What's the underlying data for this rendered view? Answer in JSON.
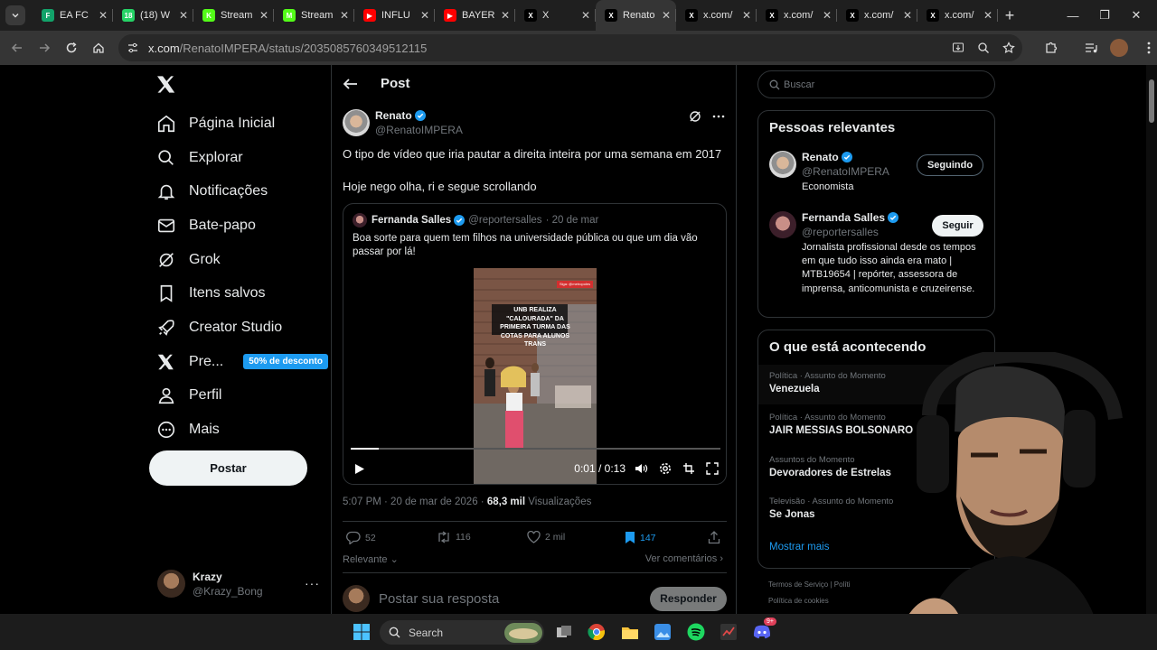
{
  "browser": {
    "tabs": [
      {
        "title": "EA FC",
        "color": "#12a36a",
        "letter": "F"
      },
      {
        "title": "(18) W",
        "color": "#25d366",
        "letter": "18"
      },
      {
        "title": "Stream",
        "color": "#53fc18",
        "letter": "K"
      },
      {
        "title": "Stream",
        "color": "#53fc18",
        "letter": "M"
      },
      {
        "title": "INFLU",
        "color": "#ff0000",
        "letter": "▶"
      },
      {
        "title": "BAYER",
        "color": "#ff0000",
        "letter": "▶"
      },
      {
        "title": "X",
        "color": "#000000",
        "letter": "X"
      },
      {
        "title": "Renato",
        "color": "#000000",
        "letter": "X"
      },
      {
        "title": "x.com/",
        "color": "#000000",
        "letter": "X"
      },
      {
        "title": "x.com/",
        "color": "#000000",
        "letter": "X"
      },
      {
        "title": "x.com/",
        "color": "#000000",
        "letter": "X"
      },
      {
        "title": "x.com/",
        "color": "#000000",
        "letter": "X"
      }
    ],
    "active_tab_index": 7,
    "url_host": "x.com",
    "url_path": "/RenatoIMPERA/status/2035085760349512115"
  },
  "nav": {
    "items": [
      {
        "label": "Página Inicial",
        "icon": "home-icon"
      },
      {
        "label": "Explorar",
        "icon": "search-icon"
      },
      {
        "label": "Notificações",
        "icon": "bell-icon"
      },
      {
        "label": "Bate-papo",
        "icon": "mail-icon"
      },
      {
        "label": "Grok",
        "icon": "grok-icon"
      },
      {
        "label": "Itens salvos",
        "icon": "bookmark-icon"
      },
      {
        "label": "Creator Studio",
        "icon": "rocket-icon"
      },
      {
        "label": "Pre...",
        "icon": "x-premium-icon"
      },
      {
        "label": "Perfil",
        "icon": "person-icon"
      },
      {
        "label": "Mais",
        "icon": "more-circle-icon"
      }
    ],
    "premium_badge": "50% de desconto",
    "post_button": "Postar",
    "account": {
      "name": "Krazy",
      "handle": "@Krazy_Bong"
    }
  },
  "post": {
    "header": "Post",
    "author_name": "Renato",
    "author_handle": "@RenatoIMPERA",
    "text_line1": "O tipo de vídeo que iria pautar a direita inteira por uma semana em 2017",
    "text_line2": "Hoje nego olha, ri e segue scrollando",
    "quote": {
      "name": "Fernanda Salles",
      "handle": "@reportersalles",
      "date": "· 20 de mar",
      "text": "Boa sorte para quem tem filhos na universidade pública ou que um dia vão passar por lá!",
      "video_caption": "UNB REALIZA \"CALOURADA\" DA PRIMEIRA TURMA DAS COTAS PARA ALUNOS TRANS",
      "video_tag": "Siga: @metropoles",
      "time": "0:01 / 0:13",
      "progress": 0.077
    },
    "meta_time": "5:07 PM · 20 de mar de 2026 ·",
    "views_count": "68,3 mil",
    "views_label": "Visualizações",
    "replies": "52",
    "reposts": "116",
    "likes": "2 mil",
    "bookmarks": "147",
    "sort_label": "Relevante",
    "view_comments": "Ver comentários",
    "reply_placeholder": "Postar sua resposta",
    "reply_button": "Responder"
  },
  "sidebar": {
    "search_placeholder": "Buscar",
    "relevant_title": "Pessoas relevantes",
    "people": [
      {
        "name": "Renato",
        "handle": "@RenatoIMPERA",
        "bio": "Economista",
        "button": "Seguindo"
      },
      {
        "name": "Fernanda Salles",
        "handle": "@reportersalles",
        "bio": "Jornalista profissional desde os tempos em que tudo isso ainda era mato | MTB19654 | repórter, assessora de imprensa, anticomunista e cruzeirense.",
        "button": "Seguir"
      }
    ],
    "trends_title": "O que está acontecendo",
    "trends": [
      {
        "context": "Política · Assunto do Momento",
        "name": "Venezuela"
      },
      {
        "context": "Política · Assunto do Momento",
        "name": "JAIR MESSIAS BOLSONARO"
      },
      {
        "context": "Assuntos do Momento",
        "name": "Devoradores de Estrelas"
      },
      {
        "context": "Televisão · Assunto do Momento",
        "name": "Se Jonas"
      }
    ],
    "show_more": "Mostrar mais",
    "footer_line1": "Termos de Serviço  |  Políti",
    "footer_line2": "Política de cookies"
  },
  "taskbar": {
    "search_label": "Search",
    "discord_badge": "9+"
  },
  "colors": {
    "accent": "#1d9bf0",
    "border": "#2f3336",
    "muted": "#71767b"
  }
}
